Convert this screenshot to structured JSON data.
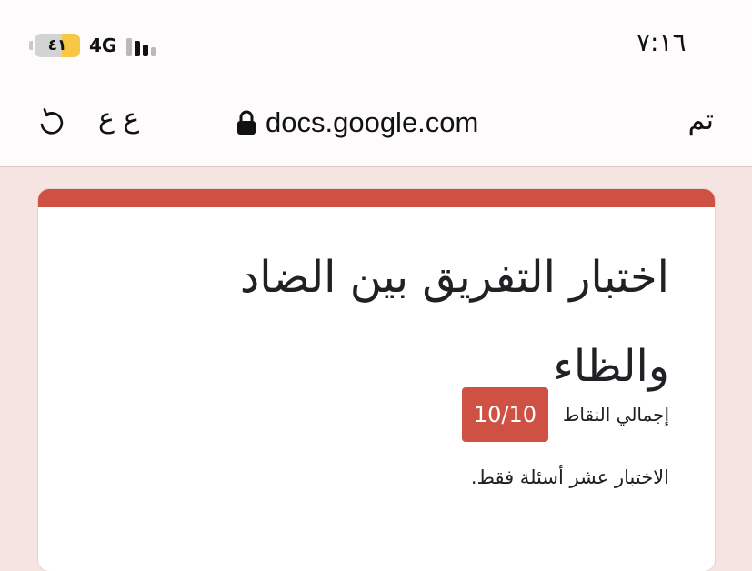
{
  "status_bar": {
    "time": "٧:١٦",
    "battery_level": "٤١",
    "battery_percent": 41,
    "network": "4G",
    "signal_bars": 4,
    "signal_active": 3
  },
  "browser": {
    "done_label": "تم",
    "domain": "docs.google.com",
    "text_size_label": "ع ع"
  },
  "form": {
    "title": "اختبار التفريق بين الضاد والظاء",
    "points_label": "إجمالي النقاط",
    "score": "10/10",
    "description": "الاختبار عشر أسئلة فقط."
  },
  "colors": {
    "accent": "#cf5143",
    "battery_fill": "#f6c846",
    "page_background": "#f6e4e3"
  }
}
